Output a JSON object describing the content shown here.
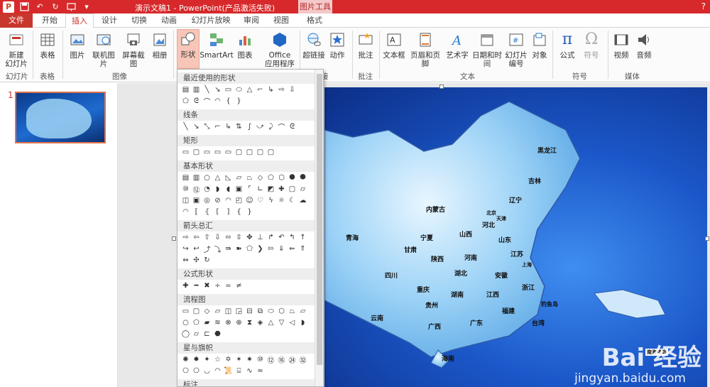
{
  "window": {
    "title": "演示文稿1 - PowerPoint(产品激活失败)",
    "context_tab": "图片工具",
    "help": "?"
  },
  "tabs": [
    {
      "label": "文件"
    },
    {
      "label": "开始"
    },
    {
      "label": "插入"
    },
    {
      "label": "设计"
    },
    {
      "label": "切换"
    },
    {
      "label": "动画"
    },
    {
      "label": "幻灯片放映"
    },
    {
      "label": "审阅"
    },
    {
      "label": "视图"
    },
    {
      "label": "格式"
    }
  ],
  "ribbon": {
    "buttons": [
      {
        "label": "新建\n幻灯片",
        "icon": "new-slide-icon"
      },
      {
        "label": "表格",
        "icon": "table-icon"
      },
      {
        "label": "图片",
        "icon": "picture-icon"
      },
      {
        "label": "联机图片",
        "icon": "online-picture-icon"
      },
      {
        "label": "屏幕截图",
        "icon": "screenshot-icon"
      },
      {
        "label": "相册",
        "icon": "album-icon"
      },
      {
        "label": "形状",
        "icon": "shapes-icon"
      },
      {
        "label": "SmartArt",
        "icon": "smartart-icon"
      },
      {
        "label": "图表",
        "icon": "chart-icon"
      },
      {
        "label": "Office\n应用程序",
        "icon": "office-apps-icon"
      },
      {
        "label": "超链接",
        "icon": "hyperlink-icon"
      },
      {
        "label": "动作",
        "icon": "action-icon"
      },
      {
        "label": "批注",
        "icon": "comment-icon"
      },
      {
        "label": "文本框",
        "icon": "textbox-icon"
      },
      {
        "label": "页眉和页脚",
        "icon": "header-footer-icon"
      },
      {
        "label": "艺术字",
        "icon": "wordart-icon"
      },
      {
        "label": "日期和时间",
        "icon": "datetime-icon"
      },
      {
        "label": "幻灯片\n编号",
        "icon": "slide-number-icon"
      },
      {
        "label": "对象",
        "icon": "object-icon"
      },
      {
        "label": "公式",
        "icon": "equation-icon"
      },
      {
        "label": "符号",
        "icon": "symbol-icon"
      },
      {
        "label": "视频",
        "icon": "video-icon"
      },
      {
        "label": "音频",
        "icon": "audio-icon"
      }
    ],
    "groups": [
      "幻灯片",
      "表格",
      "图像",
      "接",
      "批注",
      "文本",
      "符号",
      "媒体"
    ]
  },
  "slides_panel": {
    "number": "1"
  },
  "shapes_menu": {
    "sections": [
      "最近使用的形状",
      "线条",
      "矩形",
      "基本形状",
      "箭头总汇",
      "公式形状",
      "流程图",
      "星与旗帜",
      "标注"
    ]
  },
  "map_labels": [
    "黑龙江",
    "吉林",
    "辽宁",
    "内蒙古",
    "河北",
    "北京",
    "天津",
    "山西",
    "山东",
    "宁夏",
    "青海",
    "甘肃",
    "陕西",
    "河南",
    "江苏",
    "四川",
    "湖北",
    "安徽",
    "浙江",
    "重庆",
    "湖南",
    "江西",
    "贵州",
    "福建",
    "云南",
    "广西",
    "广东",
    "台湾",
    "海南",
    "钓鱼岛",
    "上海",
    "南海诸岛"
  ],
  "watermark": {
    "brand": "Bai 经验",
    "url": "jingyan.baidu.com"
  }
}
